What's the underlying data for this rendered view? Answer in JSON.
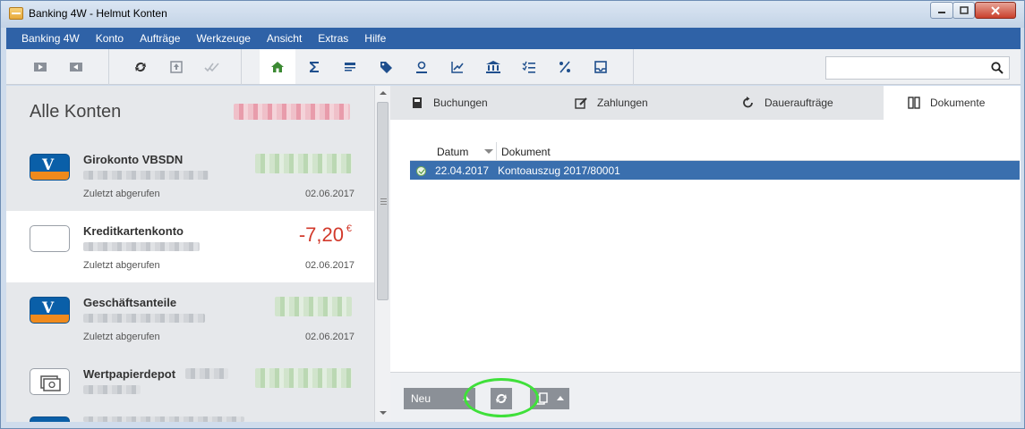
{
  "window": {
    "title": "Banking 4W - Helmut Konten"
  },
  "menu": [
    "Banking 4W",
    "Konto",
    "Aufträge",
    "Werkzeuge",
    "Ansicht",
    "Extras",
    "Hilfe"
  ],
  "toolbar": {
    "buttons": [
      "play-icon",
      "play-back-icon",
      "sync-icon",
      "upload-icon",
      "double-check-icon",
      "home-icon",
      "sum-icon",
      "list-icon",
      "tag-icon",
      "user-icon",
      "chart-icon",
      "bank-icon",
      "checklist-icon",
      "percent-icon",
      "inbox-icon"
    ],
    "active": "home-icon",
    "search": {
      "value": "",
      "placeholder": ""
    }
  },
  "sidebar": {
    "title": "Alle Konten",
    "accounts": [
      {
        "name": "Girokonto VBSDN",
        "status": "Zuletzt abgerufen",
        "date": "02.06.2017",
        "amount": "",
        "logo": "vr-bank-logo"
      },
      {
        "name": "Kreditkartenkonto",
        "status": "Zuletzt abgerufen",
        "date": "02.06.2017",
        "amount": "-7,20",
        "currency": "€",
        "logo": "card-logo"
      },
      {
        "name": "Geschäftsanteile",
        "status": "Zuletzt abgerufen",
        "date": "02.06.2017",
        "amount": "",
        "logo": "vr-bank-logo"
      },
      {
        "name": "Wertpapierdepot",
        "status": "",
        "date": "",
        "amount": "",
        "logo": "depot-logo"
      }
    ]
  },
  "tabs": [
    {
      "label": "Buchungen",
      "icon": "ledger-icon"
    },
    {
      "label": "Zahlungen",
      "icon": "edit-icon"
    },
    {
      "label": "Daueraufträge",
      "icon": "recurring-icon"
    },
    {
      "label": "Dokumente",
      "icon": "documents-icon",
      "active": true
    }
  ],
  "documents": {
    "columns": [
      "Datum",
      "Dokument"
    ],
    "rows": [
      {
        "date": "22.04.2017",
        "document": "Kontoauszug 2017/80001",
        "selected": true
      }
    ]
  },
  "bottom": {
    "new_label": "Neu"
  }
}
